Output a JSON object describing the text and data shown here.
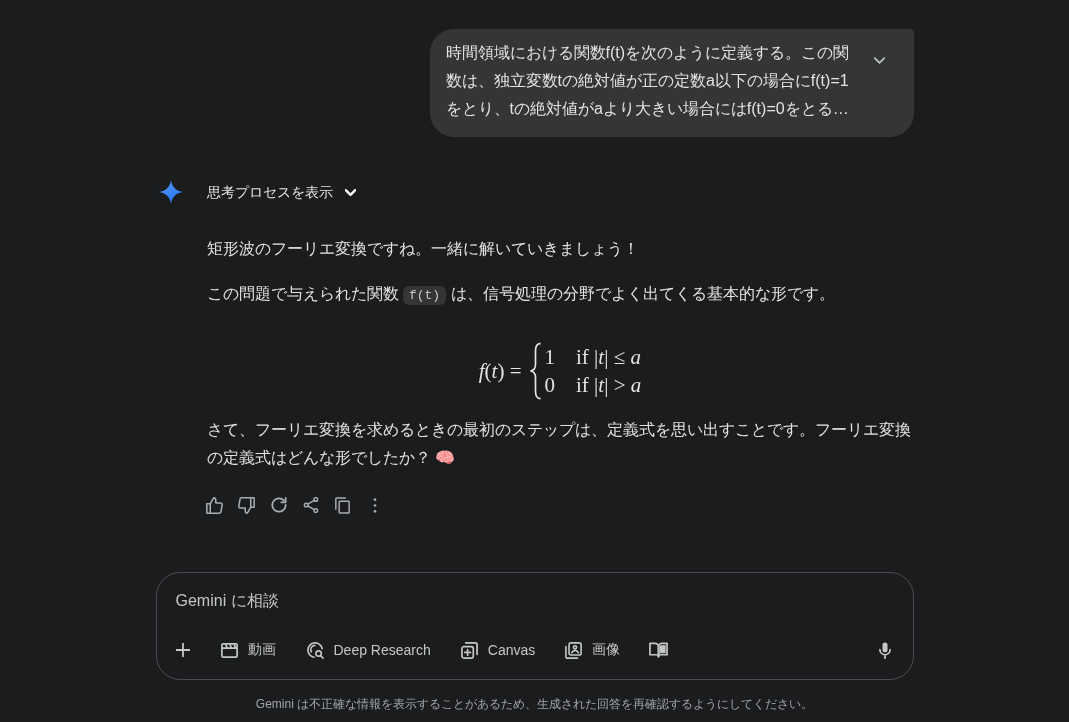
{
  "user_message": {
    "text": "時間領域における関数f(t)を次のように定義する。この関数は、独立変数tの絶対値が正の定数a以下の場合にf(t)=1をとり、tの絶対値がaより大きい場合にはf(t)=0をとる…",
    "expanded": false
  },
  "response": {
    "thoughts_toggle": {
      "label": "思考プロセスを表示",
      "expanded": false
    },
    "blocks": [
      {
        "kind": "paragraph",
        "segments": [
          {
            "kind": "text",
            "text": "矩形波のフーリエ変換ですね。一緒に解いていきましょう！"
          }
        ]
      },
      {
        "kind": "paragraph",
        "segments": [
          {
            "kind": "text",
            "text": "この問題で与えられた関数 "
          },
          {
            "kind": "code",
            "text": "f(t)"
          },
          {
            "kind": "text",
            "text": " は、信号処理の分野でよく出てくる基本的な形です。"
          }
        ]
      },
      {
        "kind": "formula",
        "lhs": "*f*(*t*) =",
        "cases": [
          {
            "value": "1",
            "condition": "if |*t*| ≤ *a*"
          },
          {
            "value": "0",
            "condition": "if |*t*| > *a*"
          }
        ]
      },
      {
        "kind": "paragraph",
        "segments": [
          {
            "kind": "text",
            "text": "さて、フーリエ変換を求めるときの最初のステップは、定義式を思い出すことです。フーリエ変換の定義式はどんな形でしたか？ 🧠"
          }
        ]
      }
    ]
  },
  "composer": {
    "placeholder": "Gemini に相談",
    "tools": [
      {
        "label": "動画"
      },
      {
        "label": "Deep Research"
      },
      {
        "label": "Canvas"
      },
      {
        "label": "画像"
      }
    ]
  },
  "disclaimer": "Gemini は不正確な情報を表示することがあるため、生成された回答を再確認するようにしてください。"
}
